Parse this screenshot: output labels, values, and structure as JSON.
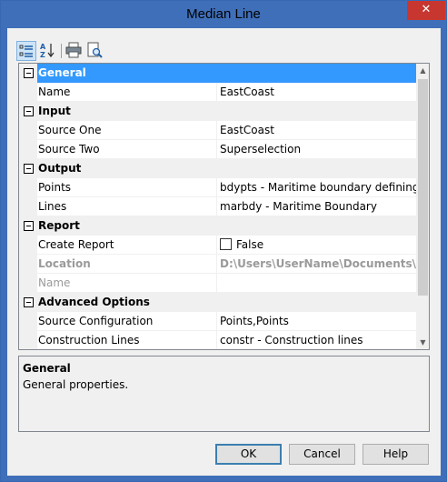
{
  "window": {
    "title": "Median Line",
    "close_glyph": "✕"
  },
  "toolbar": {
    "buttons": [
      {
        "name": "categorized-view-icon",
        "active": true
      },
      {
        "name": "sort-alphabetical-icon",
        "active": false
      },
      {
        "name": "print-icon",
        "active": false
      },
      {
        "name": "print-preview-icon",
        "active": false
      }
    ]
  },
  "grid": {
    "categories": [
      {
        "label": "General",
        "selected": true,
        "props": [
          {
            "name": "Name",
            "value": "EastCoast"
          }
        ]
      },
      {
        "label": "Input",
        "props": [
          {
            "name": "Source One",
            "value": "EastCoast"
          },
          {
            "name": "Source Two",
            "value": "Superselection"
          }
        ]
      },
      {
        "label": "Output",
        "props": [
          {
            "name": "Points",
            "value": "bdypts - Maritime boundary defining po"
          },
          {
            "name": "Lines",
            "value": "marbdy - Maritime Boundary"
          }
        ]
      },
      {
        "label": "Report",
        "props": [
          {
            "name": "Create Report",
            "value": "False",
            "checkbox": true
          },
          {
            "name": "Location",
            "value": "D:\\Users\\UserName\\Documents\\CARI",
            "disabled": true,
            "bold": true
          },
          {
            "name": "Name",
            "value": "",
            "disabled": true
          }
        ]
      },
      {
        "label": "Advanced Options",
        "props": [
          {
            "name": "Source Configuration",
            "value": "Points,Points"
          },
          {
            "name": "Construction Lines",
            "value": "constr - Construction lines"
          }
        ]
      }
    ]
  },
  "description": {
    "title": "General",
    "text": "General properties."
  },
  "buttons": {
    "ok": "OK",
    "cancel": "Cancel",
    "help": "Help"
  }
}
